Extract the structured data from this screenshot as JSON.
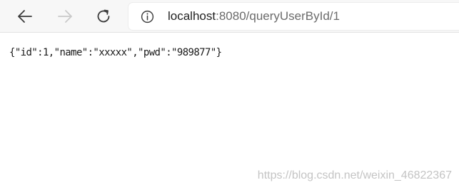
{
  "toolbar": {
    "back_icon": "arrow-left-icon",
    "forward_icon": "arrow-right-icon",
    "reload_icon": "reload-icon",
    "info_icon": "info-circle-icon"
  },
  "address": {
    "host": "localhost",
    "rest": ":8080/queryUserById/1"
  },
  "page": {
    "json_text": "{\"id\":1,\"name\":\"xxxxx\",\"pwd\":\"989877\"}"
  },
  "watermark": {
    "text": "https://blog.csdn.net/weixin_46822367"
  },
  "colors": {
    "toolbar_bg": "#f7f7f7",
    "icon_active": "#3a3a3a",
    "icon_disabled": "#c9c9c9",
    "url_host": "#1f1f1f",
    "url_rest": "#6b6b6b",
    "watermark": "#c4c4c4"
  }
}
